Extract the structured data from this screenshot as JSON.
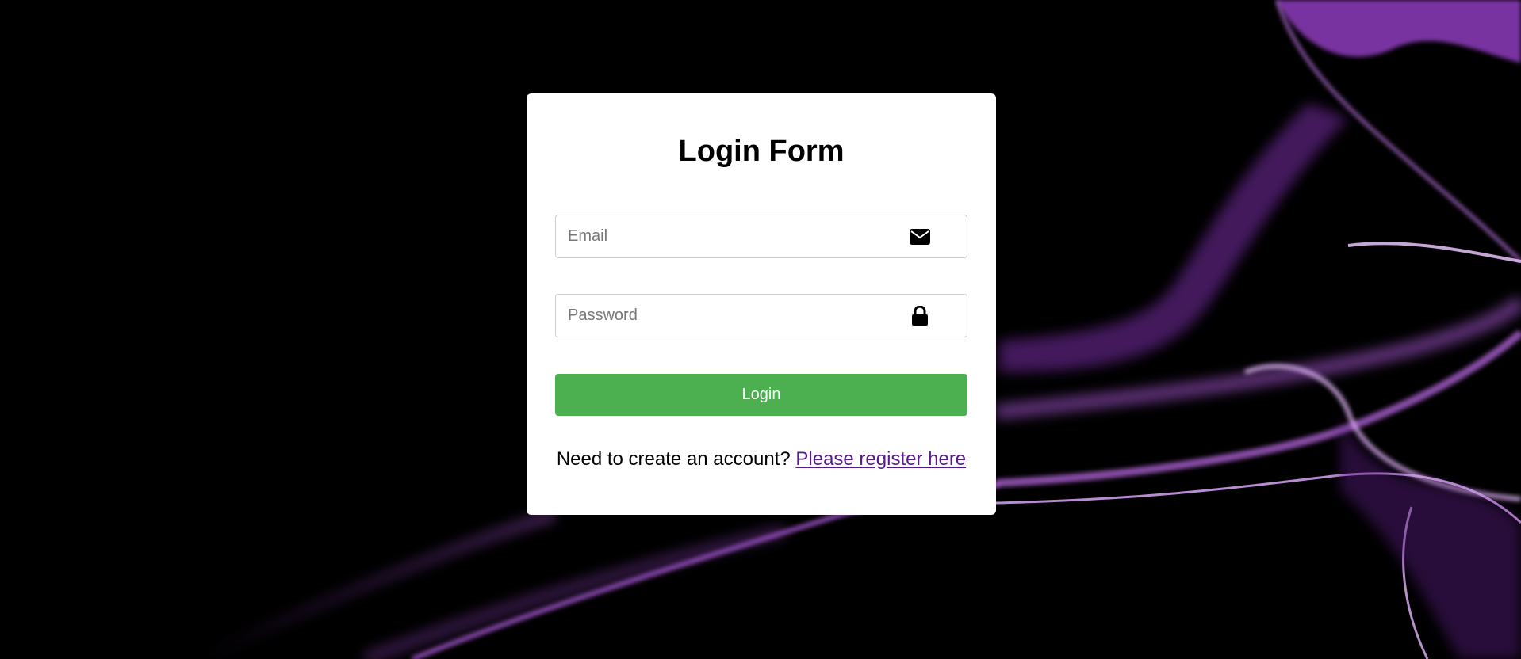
{
  "colors": {
    "background": "#000000",
    "accent_purple": "#a64bd6",
    "button_green": "#4caf50",
    "link": "#551a8b"
  },
  "form": {
    "title": "Login Form",
    "email": {
      "placeholder": "Email",
      "value": "",
      "icon": "envelope-icon"
    },
    "password": {
      "placeholder": "Password",
      "value": "",
      "icon": "lock-icon"
    },
    "login_label": "Login",
    "register_prompt": "Need to create an account?",
    "register_link": "Please register here"
  }
}
